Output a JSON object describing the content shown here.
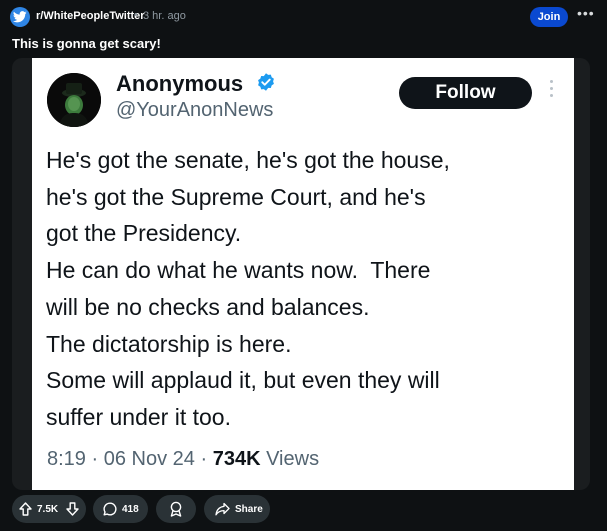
{
  "header": {
    "subreddit": "r/WhitePeopleTwitter",
    "separator": "•",
    "time": "3 hr. ago",
    "join_label": "Join",
    "more_label": "•••"
  },
  "post": {
    "title": "This is gonna get scary!"
  },
  "tweet": {
    "name": "Anonymous",
    "handle": "@YourAnonNews",
    "follow_label": "Follow",
    "text": "He's got the senate, he's got the house,\nhe's got the Supreme Court, and he's\ngot the Presidency.\nHe can do what he wants now.  There\nwill be no checks and balances.\nThe dictatorship is here.\nSome will applaud it, but even they will\nsuffer under it too.",
    "time": "8:19",
    "dot": "·",
    "date": "06 Nov 24",
    "views_count": "734K",
    "views_label": "Views"
  },
  "actions": {
    "votes": "7.5K",
    "comments": "418",
    "share_label": "Share"
  },
  "colors": {
    "background": "#0e1113",
    "accent": "#0a49d0",
    "subreddit_icon": "#2f86e6",
    "verified": "#1d9bf0",
    "pill": "#2a3236"
  },
  "icons": {
    "subreddit": "twitter-bird-icon",
    "verified": "verified-badge-icon",
    "upvote": "arrow-up-icon",
    "downvote": "arrow-down-icon",
    "comments": "comment-bubble-icon",
    "award": "award-icon",
    "share": "share-arrow-icon"
  }
}
